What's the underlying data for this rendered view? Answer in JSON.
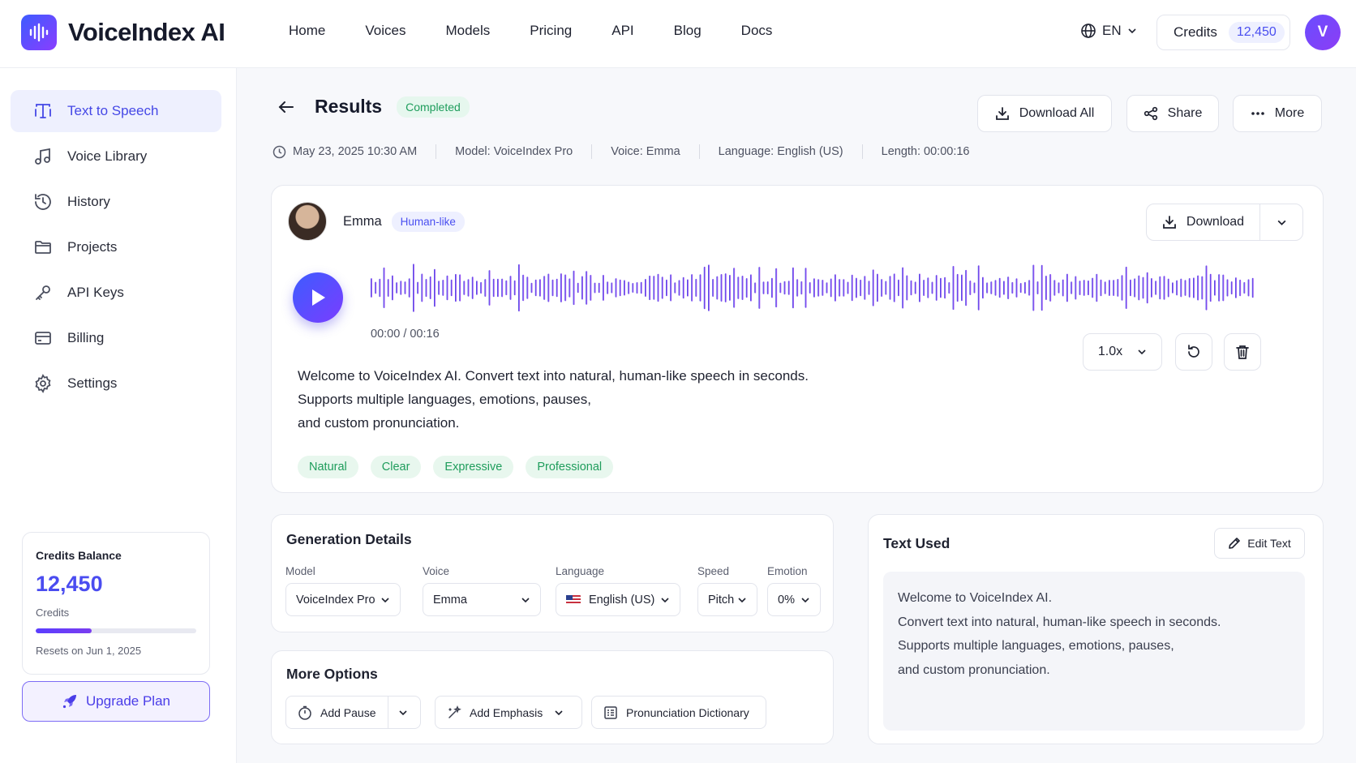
{
  "brand": {
    "name": "VoiceIndex AI"
  },
  "nav": {
    "items": [
      "Home",
      "Voices",
      "Models",
      "Pricing",
      "API",
      "Blog",
      "Docs"
    ]
  },
  "header": {
    "language": "EN",
    "credits_label": "Credits",
    "credits_value": "12,450",
    "avatar_initial": "V"
  },
  "sidebar": {
    "items": [
      {
        "label": "Text to Speech",
        "icon": "text-to-speech-icon",
        "active": true
      },
      {
        "label": "Voice Library",
        "icon": "music-note-icon",
        "active": false
      },
      {
        "label": "History",
        "icon": "history-icon",
        "active": false
      },
      {
        "label": "Projects",
        "icon": "folder-icon",
        "active": false
      },
      {
        "label": "API Keys",
        "icon": "key-icon",
        "active": false
      },
      {
        "label": "Billing",
        "icon": "credit-card-icon",
        "active": false
      },
      {
        "label": "Settings",
        "icon": "gear-icon",
        "active": false
      }
    ],
    "balance": {
      "title": "Credits Balance",
      "value": "12,450",
      "unit": "Credits",
      "usage_fraction": 0.35,
      "reset": "Resets on Jun 1, 2025"
    },
    "upgrade_label": "Upgrade Plan"
  },
  "results": {
    "title": "Results",
    "status": "Completed",
    "actions": {
      "download_all": "Download All",
      "share": "Share",
      "more": "More"
    },
    "meta": {
      "date": "May 23, 2025 10:30 AM",
      "model": "Model: VoiceIndex Pro",
      "voice": "Voice: Emma",
      "language": "Language: English (US)",
      "length": "Length: 00:00:16"
    }
  },
  "player": {
    "speaker_name": "Emma",
    "speaker_badge": "Human-like",
    "download_label": "Download",
    "time": "00:00 / 00:16",
    "speed": "1.0x",
    "script_lines": [
      "Welcome to VoiceIndex AI. Convert text into natural, human-like speech in seconds.",
      "Supports multiple languages, emotions, pauses,",
      "and custom pronunciation."
    ],
    "tags": [
      "Natural",
      "Clear",
      "Expressive",
      "Professional"
    ]
  },
  "generation": {
    "title": "Generation Details",
    "fields": [
      {
        "label": "Model",
        "value": "VoiceIndex Pro"
      },
      {
        "label": "Voice",
        "value": "Emma"
      },
      {
        "label": "Language",
        "value": "English (US)"
      },
      {
        "label": "Speed",
        "value": "Pitch"
      },
      {
        "label": "Emotion",
        "value": "0%"
      }
    ]
  },
  "more_options": {
    "title": "More Options",
    "add_pause": "Add Pause",
    "add_emphasis": "Add Emphasis",
    "pronunciation": "Pronunciation Dictionary"
  },
  "text_used": {
    "title": "Text Used",
    "edit_label": "Edit Text",
    "lines": [
      "Welcome to VoiceIndex AI.",
      "Convert text into natural, human-like speech in seconds.",
      "Supports multiple languages, emotions, pauses,",
      "and custom pronunciation."
    ]
  },
  "colors": {
    "accent": "#4a4cf0",
    "success": "#1f9d5c",
    "wave_start": "#2f4fe0",
    "wave_end": "#c08af5"
  }
}
